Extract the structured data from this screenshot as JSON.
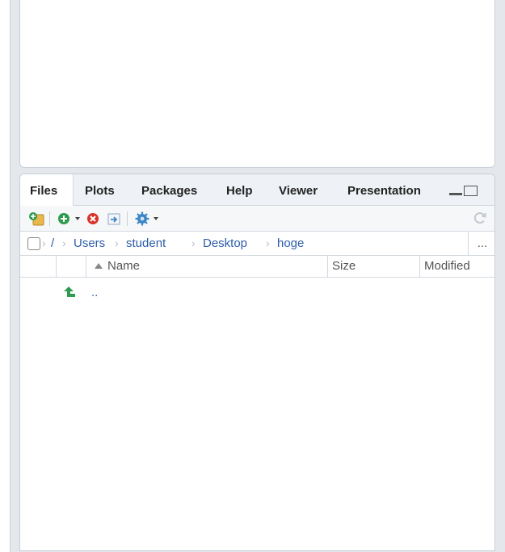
{
  "tabs": [
    {
      "label": "Files",
      "active": true
    },
    {
      "label": "Plots",
      "active": false
    },
    {
      "label": "Packages",
      "active": false
    },
    {
      "label": "Help",
      "active": false
    },
    {
      "label": "Viewer",
      "active": false
    },
    {
      "label": "Presentation",
      "active": false
    }
  ],
  "toolbar": {
    "icons": [
      "new-folder-icon",
      "new-file-icon",
      "delete-icon",
      "rename-icon",
      "more-gear-icon",
      "refresh-icon"
    ]
  },
  "path": {
    "root": "/",
    "crumbs": [
      "Users",
      "student",
      "Desktop",
      "hoge"
    ],
    "more": "..."
  },
  "columns": {
    "name": "Name",
    "size": "Size",
    "modified": "Modified"
  },
  "rows": [
    {
      "name": ".."
    }
  ],
  "colors": {
    "link": "#2d5da8",
    "accent_green": "#2e9b4f",
    "delete_red": "#d9342b",
    "gear_blue": "#3d85c6"
  }
}
